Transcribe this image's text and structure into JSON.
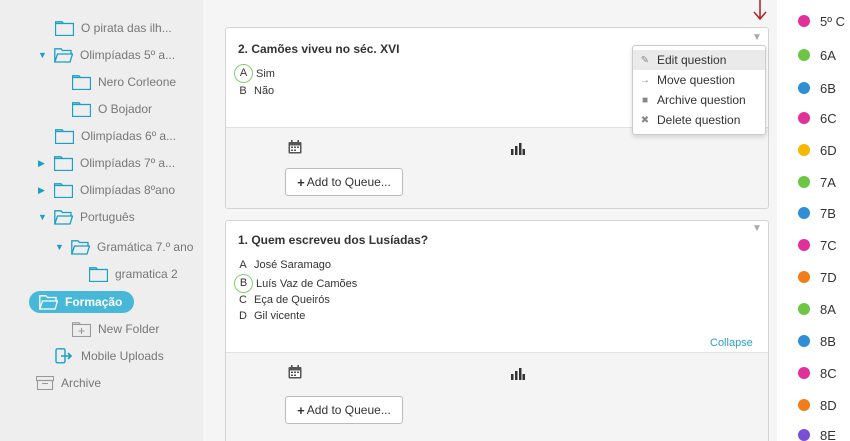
{
  "sidebar": {
    "items": [
      {
        "label": "O pirata das ilh..."
      },
      {
        "label": "Olimpíadas 5º a..."
      },
      {
        "label": "Nero Corleone"
      },
      {
        "label": "O Bojador"
      },
      {
        "label": "Olimpíadas 6º a..."
      },
      {
        "label": "Olimpíadas 7º a..."
      },
      {
        "label": "Olimpíadas 8ºano"
      },
      {
        "label": "Português"
      },
      {
        "label": "Gramática 7.º ano"
      },
      {
        "label": "gramatica 2"
      },
      {
        "label": "Formação"
      },
      {
        "label": "New Folder"
      },
      {
        "label": "Mobile Uploads"
      },
      {
        "label": "Archive"
      }
    ]
  },
  "questions": [
    {
      "title": "2. Camões viveu no séc. XVI",
      "options": [
        {
          "letter": "A",
          "text": "Sim",
          "correct": true
        },
        {
          "letter": "B",
          "text": "Não",
          "correct": false
        }
      ],
      "queue_label": "Add to Queue..."
    },
    {
      "title": "1. Quem escreveu dos Lusíadas?",
      "options": [
        {
          "letter": "A",
          "text": "José Saramago",
          "correct": false
        },
        {
          "letter": "B",
          "text": "Luís Vaz de Camões",
          "correct": true
        },
        {
          "letter": "C",
          "text": "Eça de Queirós",
          "correct": false
        },
        {
          "letter": "D",
          "text": "Gil vicente",
          "correct": false
        }
      ],
      "collapse_label": "Collapse",
      "queue_label": "Add to Queue..."
    }
  ],
  "menu": {
    "items": [
      {
        "label": "Edit question",
        "icon": "pencil-icon"
      },
      {
        "label": "Move question",
        "icon": "arrow-right-icon"
      },
      {
        "label": "Archive question",
        "icon": "archive-icon"
      },
      {
        "label": "Delete question",
        "icon": "x-icon"
      }
    ]
  },
  "classes": [
    {
      "label": "5º C",
      "color": "#e0309a"
    },
    {
      "label": "6A",
      "color": "#6cc644"
    },
    {
      "label": "6B",
      "color": "#2f8ed6"
    },
    {
      "label": "6C",
      "color": "#e0309a"
    },
    {
      "label": "6D",
      "color": "#f5b800"
    },
    {
      "label": "7A",
      "color": "#6cc644"
    },
    {
      "label": "7B",
      "color": "#2f8ed6"
    },
    {
      "label": "7C",
      "color": "#e0309a"
    },
    {
      "label": "7D",
      "color": "#f07d1a"
    },
    {
      "label": "8A",
      "color": "#6cc644"
    },
    {
      "label": "8B",
      "color": "#2f8ed6"
    },
    {
      "label": "8C",
      "color": "#e0309a"
    },
    {
      "label": "8D",
      "color": "#f07d1a"
    },
    {
      "label": "8E",
      "color": "#7a4fd6"
    }
  ],
  "colors": {
    "accent": "#47b8d8",
    "correct": "#7ed06c",
    "link": "#2a9fd0"
  }
}
